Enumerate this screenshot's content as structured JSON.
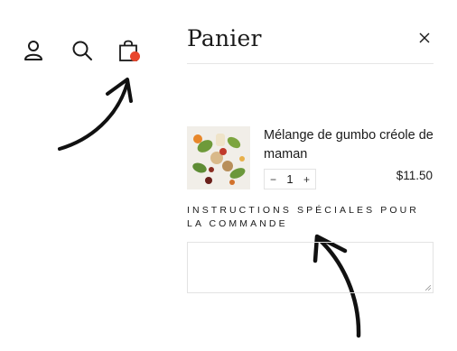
{
  "header_icons": {
    "account": "user-icon",
    "search": "search-icon",
    "cart": "shopping-bag-icon"
  },
  "colors": {
    "cart_badge": "#e8462d",
    "text": "#1a1a1a",
    "border": "#e3e3e3"
  },
  "cart": {
    "title": "Panier",
    "close_icon": "close-icon",
    "items": [
      {
        "name": "Mélange de gumbo créole de maman",
        "quantity": "1",
        "minus_label": "−",
        "plus_label": "+",
        "price": "$11.50"
      }
    ],
    "instructions_label": "INSTRUCTIONS SPÉCIALES POUR LA COMMANDE",
    "instructions_value": ""
  }
}
